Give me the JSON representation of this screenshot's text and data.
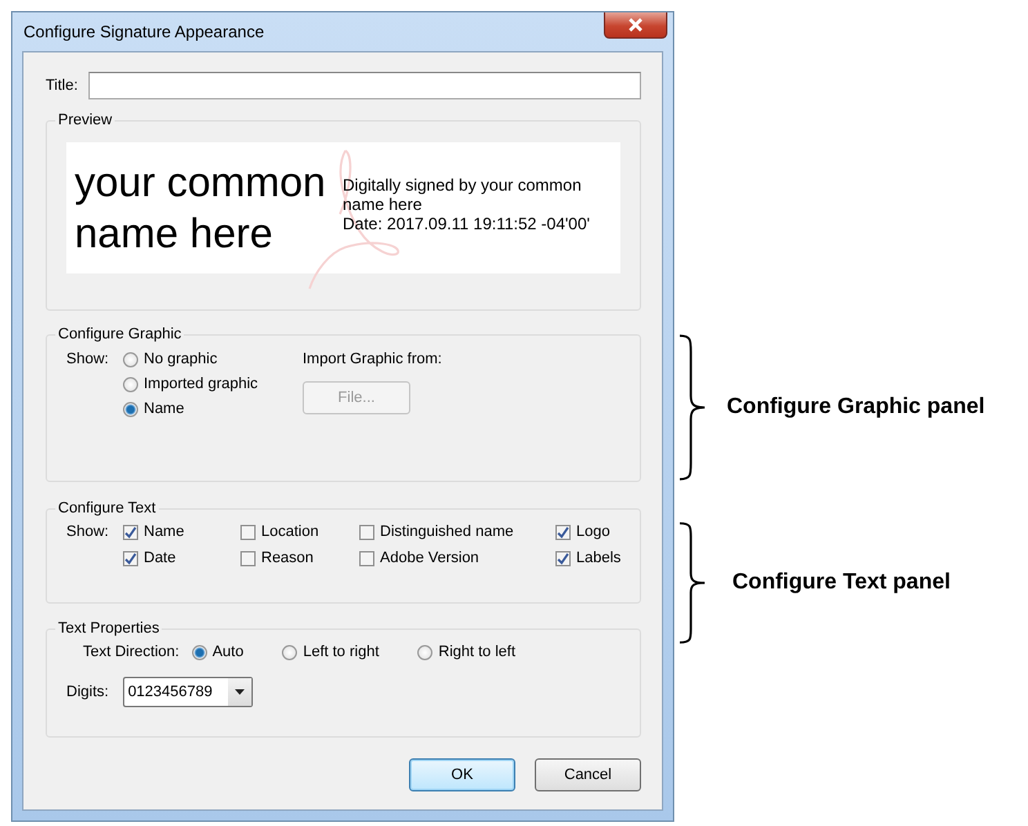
{
  "window": {
    "title": "Configure Signature Appearance"
  },
  "title_field": {
    "label": "Title:"
  },
  "preview": {
    "label": "Preview",
    "name": "your common name here",
    "signed_by": "Digitally signed by your common name here",
    "date": "Date: 2017.09.11 19:11:52 -04'00'"
  },
  "configure_graphic": {
    "label": "Configure Graphic",
    "show_label": "Show:",
    "options": [
      {
        "label": "No graphic",
        "selected": false
      },
      {
        "label": "Imported graphic",
        "selected": false
      },
      {
        "label": "Name",
        "selected": true
      }
    ],
    "import_label": "Import Graphic from:",
    "file_button": {
      "label": "File...",
      "disabled": true
    }
  },
  "configure_text": {
    "label": "Configure Text",
    "show_label": "Show:",
    "options": [
      {
        "label": "Name",
        "checked": true
      },
      {
        "label": "Location",
        "checked": false
      },
      {
        "label": "Distinguished name",
        "checked": false
      },
      {
        "label": "Logo",
        "checked": true
      },
      {
        "label": "Date",
        "checked": true
      },
      {
        "label": "Reason",
        "checked": false
      },
      {
        "label": "Adobe Version",
        "checked": false
      },
      {
        "label": "Labels",
        "checked": true
      }
    ]
  },
  "text_properties": {
    "label": "Text Properties",
    "direction_label": "Text Direction:",
    "directions": [
      {
        "label": "Auto",
        "selected": true
      },
      {
        "label": "Left to right",
        "selected": false
      },
      {
        "label": "Right to left",
        "selected": false
      }
    ],
    "digits_label": "Digits:",
    "digits": {
      "value": "0123456789"
    }
  },
  "buttons": [
    {
      "label": "OK",
      "default": true
    },
    {
      "label": "Cancel",
      "default": false
    }
  ],
  "annotations": [
    {
      "label": "Configure Graphic panel"
    },
    {
      "label": "Configure Text panel"
    }
  ]
}
